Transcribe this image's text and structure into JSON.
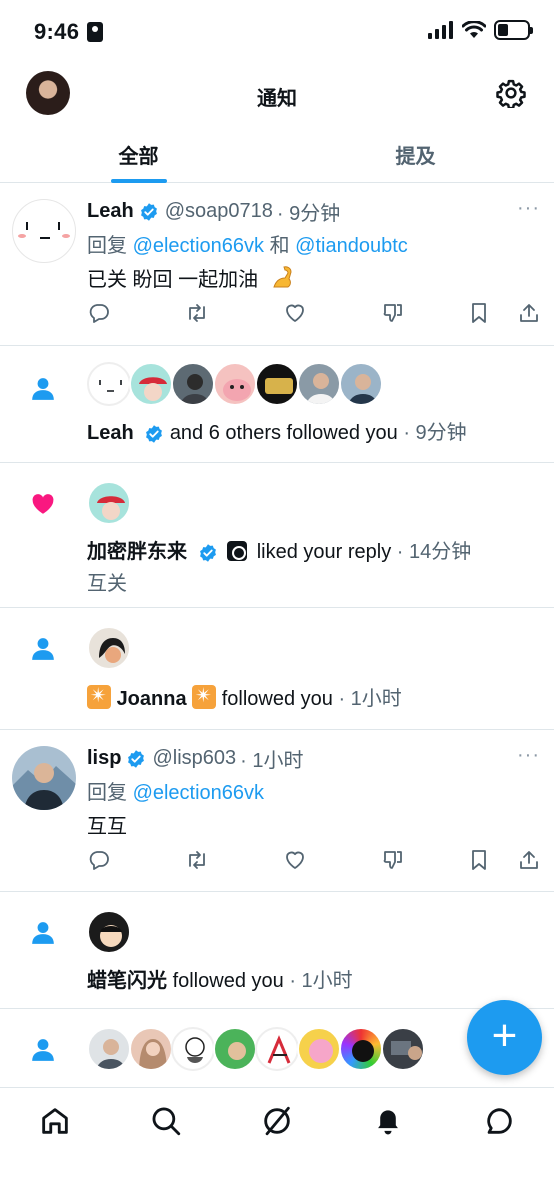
{
  "status_bar": {
    "time": "9:46"
  },
  "header": {
    "title": "通知"
  },
  "tabs": [
    {
      "label": "全部",
      "active": true
    },
    {
      "label": "提及",
      "active": false
    }
  ],
  "tweet1": {
    "name": "Leah",
    "handle": "@soap0718",
    "time": "· 9分钟",
    "reply_prefix": "回复",
    "reply_user1": "@election66vk",
    "reply_and": "和",
    "reply_user2": "@tiandoubtc",
    "text": "已关  盼回  一起加油",
    "more": "···"
  },
  "follow1": {
    "name": "Leah",
    "action": "and 6 others followed you",
    "time": "· 9分钟"
  },
  "like1": {
    "name": "加密胖东来",
    "action": "liked your reply",
    "time": "· 14分钟",
    "sub": "互关"
  },
  "follow2": {
    "name": "Joanna",
    "action": "followed you",
    "time": "· 1小时"
  },
  "tweet2": {
    "name": "lisp",
    "handle": "@lisp603",
    "time": "· 1小时",
    "reply_prefix": "回复",
    "reply_user1": "@election66vk",
    "text": "互互",
    "more": "···"
  },
  "follow3": {
    "name": "蜡笔闪光",
    "action": "followed you",
    "time": "· 1小时"
  },
  "fab": {
    "label": "+"
  },
  "colors": {
    "accent": "#1d9bf0",
    "like": "#f91880",
    "text": "#0f1419",
    "muted": "#536471"
  }
}
